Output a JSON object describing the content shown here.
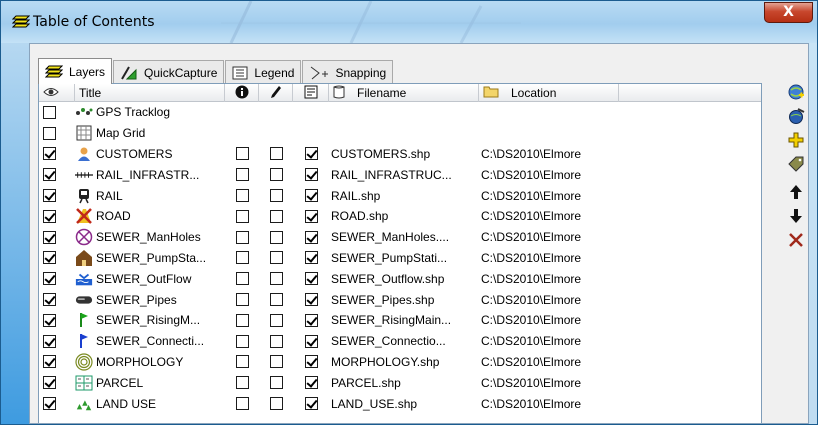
{
  "window": {
    "title": "Table of Contents",
    "close_label": "X"
  },
  "tabs": [
    {
      "label": "Layers",
      "icon": "layers-icon",
      "active": true
    },
    {
      "label": "QuickCapture",
      "icon": "quickcapture-icon",
      "active": false
    },
    {
      "label": "Legend",
      "icon": "legend-icon",
      "active": false
    },
    {
      "label": "Snapping",
      "icon": "snapping-icon",
      "active": false
    }
  ],
  "columns": {
    "visibility": "",
    "title": "Title",
    "info": "",
    "edit": "",
    "snap": "",
    "filename": "Filename",
    "location": "Location"
  },
  "layers": [
    {
      "visible": false,
      "title": "GPS Tracklog",
      "icon": "gps-tracklog-icon",
      "has_cols": false,
      "filename": "",
      "location": ""
    },
    {
      "visible": false,
      "title": "Map Grid",
      "icon": "map-grid-icon",
      "has_cols": false,
      "filename": "",
      "location": ""
    },
    {
      "visible": true,
      "title": "CUSTOMERS",
      "icon": "customers-icon",
      "has_cols": true,
      "info": false,
      "edit": false,
      "snap": true,
      "filename": "CUSTOMERS.shp",
      "location": "C:\\DS2010\\Elmore"
    },
    {
      "visible": true,
      "title": "RAIL_INFRASTR...",
      "icon": "rail-infrastructure-icon",
      "has_cols": true,
      "info": false,
      "edit": false,
      "snap": true,
      "filename": "RAIL_INFRASTRUC...",
      "location": "C:\\DS2010\\Elmore"
    },
    {
      "visible": true,
      "title": "RAIL",
      "icon": "rail-icon",
      "has_cols": true,
      "info": false,
      "edit": false,
      "snap": true,
      "filename": "RAIL.shp",
      "location": "C:\\DS2010\\Elmore"
    },
    {
      "visible": true,
      "title": "ROAD",
      "icon": "road-icon",
      "has_cols": true,
      "info": false,
      "edit": false,
      "snap": true,
      "filename": "ROAD.shp",
      "location": "C:\\DS2010\\Elmore"
    },
    {
      "visible": true,
      "title": "SEWER_ManHoles",
      "icon": "manhole-icon",
      "has_cols": true,
      "info": false,
      "edit": false,
      "snap": true,
      "filename": "SEWER_ManHoles....",
      "location": "C:\\DS2010\\Elmore"
    },
    {
      "visible": true,
      "title": "SEWER_PumpSta...",
      "icon": "pumpstation-icon",
      "has_cols": true,
      "info": false,
      "edit": false,
      "snap": true,
      "filename": "SEWER_PumpStati...",
      "location": "C:\\DS2010\\Elmore"
    },
    {
      "visible": true,
      "title": "SEWER_OutFlow",
      "icon": "outflow-icon",
      "has_cols": true,
      "info": false,
      "edit": false,
      "snap": true,
      "filename": "SEWER_Outflow.shp",
      "location": "C:\\DS2010\\Elmore"
    },
    {
      "visible": true,
      "title": "SEWER_Pipes",
      "icon": "pipes-icon",
      "has_cols": true,
      "info": false,
      "edit": false,
      "snap": true,
      "filename": "SEWER_Pipes.shp",
      "location": "C:\\DS2010\\Elmore"
    },
    {
      "visible": true,
      "title": "SEWER_RisingM...",
      "icon": "risingmain-flag-icon",
      "has_cols": true,
      "info": false,
      "edit": false,
      "snap": true,
      "filename": "SEWER_RisingMain...",
      "location": "C:\\DS2010\\Elmore"
    },
    {
      "visible": true,
      "title": "SEWER_Connecti...",
      "icon": "connection-flag-icon",
      "has_cols": true,
      "info": false,
      "edit": false,
      "snap": true,
      "filename": "SEWER_Connectio...",
      "location": "C:\\DS2010\\Elmore"
    },
    {
      "visible": true,
      "title": "MORPHOLOGY",
      "icon": "morphology-icon",
      "has_cols": true,
      "info": false,
      "edit": false,
      "snap": true,
      "filename": "MORPHOLOGY.shp",
      "location": "C:\\DS2010\\Elmore"
    },
    {
      "visible": true,
      "title": "PARCEL",
      "icon": "parcel-icon",
      "has_cols": true,
      "info": false,
      "edit": false,
      "snap": true,
      "filename": "PARCEL.shp",
      "location": "C:\\DS2010\\Elmore"
    },
    {
      "visible": true,
      "title": "LAND USE",
      "icon": "land-use-icon",
      "has_cols": true,
      "info": false,
      "edit": false,
      "snap": true,
      "filename": "LAND_USE.shp",
      "location": "C:\\DS2010\\Elmore"
    }
  ],
  "toolbar": [
    {
      "icon": "add-layer-icon"
    },
    {
      "icon": "layer-properties-icon"
    },
    {
      "icon": "add-icon"
    },
    {
      "icon": "label-tag-icon"
    },
    {
      "icon": "move-up-icon"
    },
    {
      "icon": "move-down-icon"
    },
    {
      "icon": "remove-icon"
    }
  ]
}
